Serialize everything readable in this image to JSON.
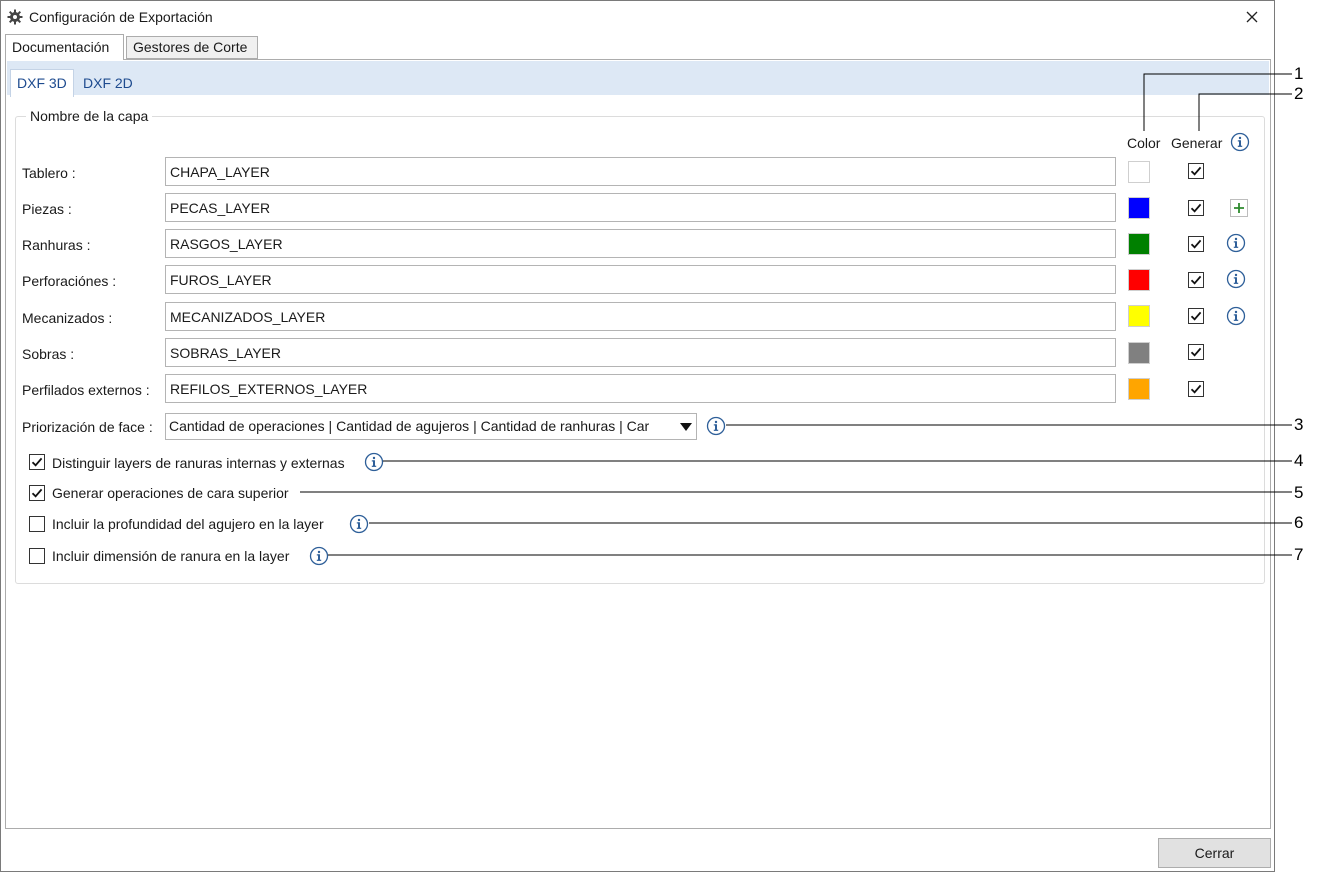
{
  "window": {
    "title": "Configuración de Exportación",
    "icon": "gear-icon",
    "close_icon": "close-icon"
  },
  "outer_tabs": [
    {
      "label": "Documentación",
      "active": true
    },
    {
      "label": "Gestores de Corte",
      "active": false
    }
  ],
  "inner_tabs": [
    {
      "label": "DXF 3D",
      "active": true
    },
    {
      "label": "DXF 2D",
      "active": false
    }
  ],
  "group": {
    "legend": "Nombre de la capa",
    "header_color": "Color",
    "header_generate": "Generar"
  },
  "layers": [
    {
      "label": "Tablero :",
      "value": "CHAPA_LAYER",
      "color": "#FFFFFF",
      "generate": true,
      "extra": "none"
    },
    {
      "label": "Piezas :",
      "value": "PECAS_LAYER",
      "color": "#0000FF",
      "generate": true,
      "extra": "plus-icon"
    },
    {
      "label": "Ranhuras :",
      "value": "RASGOS_LAYER",
      "color": "#008000",
      "generate": true,
      "extra": "info-icon"
    },
    {
      "label": "Perforaciónes :",
      "value": "FUROS_LAYER",
      "color": "#FF0000",
      "generate": true,
      "extra": "info-icon"
    },
    {
      "label": "Mecanizados :",
      "value": "MECANIZADOS_LAYER",
      "color": "#FFFF00",
      "generate": true,
      "extra": "info-icon"
    },
    {
      "label": "Sobras :",
      "value": "SOBRAS_LAYER",
      "color": "#808080",
      "generate": true,
      "extra": "none"
    },
    {
      "label": "Perfilados externos :",
      "value": "REFILOS_EXTERNOS_LAYER",
      "color": "#FFA500",
      "generate": true,
      "extra": "none"
    }
  ],
  "face_priority": {
    "label": "Priorización de face :",
    "selected": "Cantidad de operaciones | Cantidad de agujeros | Cantidad de ranhuras | Car"
  },
  "options": [
    {
      "label": "Distinguir layers de ranuras internas y externas",
      "checked": true,
      "info": true
    },
    {
      "label": "Generar operaciones de cara superior",
      "checked": true,
      "info": false
    },
    {
      "label": "Incluir la profundidad del agujero en la layer",
      "checked": false,
      "info": true
    },
    {
      "label": "Incluir dimensión de ranura en la layer",
      "checked": false,
      "info": true
    }
  ],
  "footer": {
    "close_label": "Cerrar"
  },
  "callouts": [
    "1",
    "2",
    "3",
    "4",
    "5",
    "6",
    "7"
  ]
}
